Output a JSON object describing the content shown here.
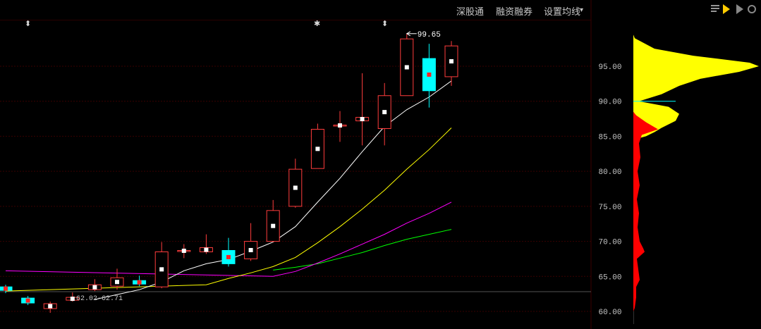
{
  "toolbar": {
    "items": [
      "深股通",
      "融资融券",
      "设置均线"
    ],
    "dropdown_glyph": "▾"
  },
  "markers": {
    "up_down_glyph": "⬍",
    "star_glyph": "✱"
  },
  "colors": {
    "up": "#ff3c3c",
    "down": "#00ffff",
    "background": "#000000",
    "ma5": "#ffffff",
    "ma10": "#ffff00",
    "ma20": "#ff00ff",
    "ma30": "#00ff00",
    "price_axis": "#c8c8c8",
    "grid": "#3a0000",
    "volume_profile_a": "#ffff00",
    "volume_profile_b": "#ff0000"
  },
  "chart_data": {
    "type": "candlestick",
    "y_axis": {
      "ticks": [
        "95.00",
        "90.00",
        "85.00",
        "80.00",
        "75.00",
        "70.00",
        "65.00",
        "60.00"
      ],
      "range": [
        59,
        100
      ]
    },
    "annotations": {
      "high_label": "99.65",
      "low_label": "62.02-62.71"
    },
    "candles": [
      {
        "o": 63.5,
        "c": 63.0,
        "h": 63.8,
        "l": 62.6
      },
      {
        "o": 61.9,
        "c": 61.2,
        "h": 62.2,
        "l": 60.9
      },
      {
        "o": 60.4,
        "c": 61.1,
        "h": 61.4,
        "l": 59.8
      },
      {
        "o": 61.6,
        "c": 62.0,
        "h": 62.7,
        "l": 61.4
      },
      {
        "o": 63.1,
        "c": 63.8,
        "h": 64.6,
        "l": 62.9
      },
      {
        "o": 63.6,
        "c": 64.8,
        "h": 66.1,
        "l": 63.1
      },
      {
        "o": 64.4,
        "c": 63.9,
        "h": 65.1,
        "l": 63.6
      },
      {
        "o": 63.5,
        "c": 68.5,
        "h": 69.9,
        "l": 63.3
      },
      {
        "o": 68.6,
        "c": 68.7,
        "h": 69.6,
        "l": 67.6
      },
      {
        "o": 68.5,
        "c": 69.1,
        "h": 71.0,
        "l": 68.2
      },
      {
        "o": 68.7,
        "c": 66.8,
        "h": 70.5,
        "l": 66.4
      },
      {
        "o": 67.5,
        "c": 70.0,
        "h": 72.6,
        "l": 67.2
      },
      {
        "o": 70.0,
        "c": 74.4,
        "h": 75.9,
        "l": 69.9
      },
      {
        "o": 75.0,
        "c": 80.3,
        "h": 81.8,
        "l": 74.8
      },
      {
        "o": 80.4,
        "c": 86.0,
        "h": 86.8,
        "l": 80.4
      },
      {
        "o": 86.5,
        "c": 86.6,
        "h": 88.6,
        "l": 84.2
      },
      {
        "o": 87.2,
        "c": 87.7,
        "h": 94.0,
        "l": 83.7
      },
      {
        "o": 86.1,
        "c": 90.8,
        "h": 92.6,
        "l": 83.7
      },
      {
        "o": 90.8,
        "c": 98.9,
        "h": 99.65,
        "l": 90.8
      },
      {
        "o": 96.1,
        "c": 91.5,
        "h": 98.2,
        "l": 89.1
      },
      {
        "o": 93.5,
        "c": 97.9,
        "h": 98.6,
        "l": 92.2
      }
    ],
    "ma5": [
      null,
      null,
      null,
      null,
      61.7,
      62.4,
      63.1,
      64.2,
      65.8,
      66.8,
      67.4,
      68.6,
      69.9,
      72.1,
      75.6,
      79.0,
      82.8,
      86.4,
      88.8,
      90.6,
      92.9
    ],
    "ma10": [
      62.9,
      null,
      null,
      null,
      null,
      null,
      null,
      null,
      null,
      63.8,
      64.7,
      65.5,
      66.4,
      67.7,
      69.8,
      72.1,
      74.6,
      77.3,
      80.3,
      83.1,
      86.2
    ],
    "ma20": [
      65.8,
      null,
      null,
      null,
      null,
      null,
      null,
      null,
      null,
      null,
      null,
      null,
      65.0,
      65.7,
      66.9,
      68.2,
      69.6,
      71.0,
      72.6,
      74.0,
      75.6
    ],
    "ma30": [
      null,
      null,
      null,
      null,
      null,
      null,
      null,
      null,
      null,
      null,
      null,
      null,
      65.9,
      66.3,
      66.8,
      67.6,
      68.4,
      69.4,
      70.3,
      71.0,
      71.7
    ]
  }
}
